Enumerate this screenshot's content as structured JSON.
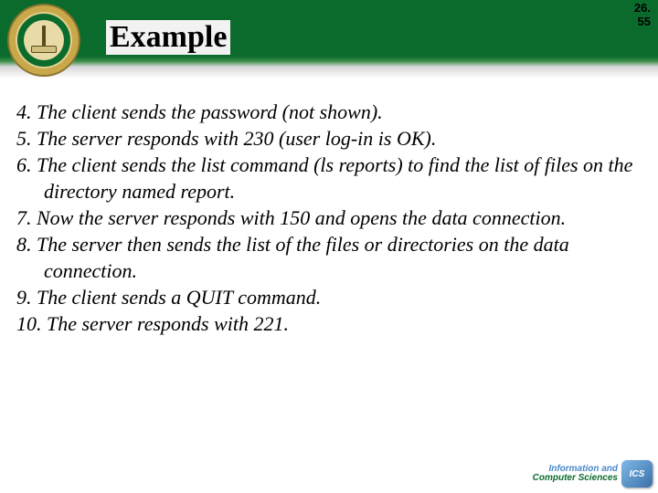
{
  "page": {
    "current": "26.",
    "total": "55"
  },
  "title": "Example",
  "items": [
    "4. The client sends the password (not shown).",
    "5. The server responds with 230 (user log-in is OK).",
    "6. The client sends the list command (ls reports) to find the list of files on the directory named report.",
    "7. Now the server responds with 150 and opens the data connection.",
    "8. The server then sends the list of the files or directories on the data connection.",
    "9. The client sends a QUIT command.",
    "10. The  server responds with 221."
  ],
  "footer": {
    "line1": "Information and",
    "line2": "Computer Sciences",
    "badge": "ICS"
  }
}
